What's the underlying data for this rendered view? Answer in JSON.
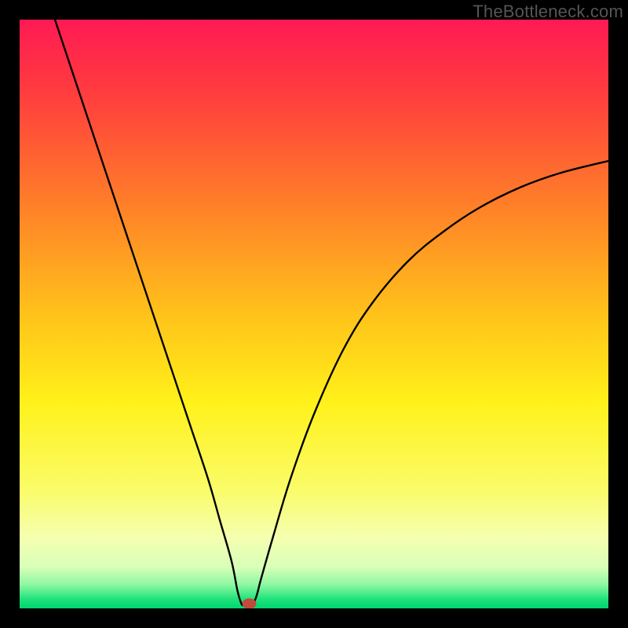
{
  "watermark": "TheBottleneck.com",
  "chart_data": {
    "type": "line",
    "title": "",
    "xlabel": "",
    "ylabel": "",
    "xlim": [
      0,
      100
    ],
    "ylim": [
      0,
      100
    ],
    "background_gradient": {
      "stops": [
        {
          "offset": 0.0,
          "color": "#ff1a53"
        },
        {
          "offset": 0.12,
          "color": "#ff3b3f"
        },
        {
          "offset": 0.3,
          "color": "#ff7a2a"
        },
        {
          "offset": 0.5,
          "color": "#ffc21a"
        },
        {
          "offset": 0.65,
          "color": "#fff11a"
        },
        {
          "offset": 0.8,
          "color": "#fafc6a"
        },
        {
          "offset": 0.88,
          "color": "#f5ffb0"
        },
        {
          "offset": 0.93,
          "color": "#d8ffb8"
        },
        {
          "offset": 0.96,
          "color": "#8cf7a2"
        },
        {
          "offset": 0.985,
          "color": "#1de27a"
        },
        {
          "offset": 1.0,
          "color": "#00d56f"
        }
      ]
    },
    "curve": {
      "description": "V-shaped bottleneck curve with sharp minimum",
      "min_x": 38,
      "min_y": 0,
      "points": [
        {
          "x": 6.0,
          "y": 100.0
        },
        {
          "x": 8.0,
          "y": 94.0
        },
        {
          "x": 11.0,
          "y": 85.0
        },
        {
          "x": 14.0,
          "y": 76.0
        },
        {
          "x": 17.0,
          "y": 67.0
        },
        {
          "x": 20.0,
          "y": 58.0
        },
        {
          "x": 23.0,
          "y": 49.0
        },
        {
          "x": 26.0,
          "y": 40.0
        },
        {
          "x": 29.0,
          "y": 31.0
        },
        {
          "x": 32.0,
          "y": 22.0
        },
        {
          "x": 34.0,
          "y": 15.0
        },
        {
          "x": 36.0,
          "y": 8.0
        },
        {
          "x": 37.0,
          "y": 3.0
        },
        {
          "x": 37.6,
          "y": 1.0
        },
        {
          "x": 38.0,
          "y": 0.5
        },
        {
          "x": 39.4,
          "y": 0.5
        },
        {
          "x": 40.2,
          "y": 2.0
        },
        {
          "x": 41.0,
          "y": 5.0
        },
        {
          "x": 43.0,
          "y": 12.0
        },
        {
          "x": 46.0,
          "y": 22.0
        },
        {
          "x": 50.0,
          "y": 33.0
        },
        {
          "x": 55.0,
          "y": 44.0
        },
        {
          "x": 60.0,
          "y": 52.0
        },
        {
          "x": 66.0,
          "y": 59.0
        },
        {
          "x": 72.0,
          "y": 64.0
        },
        {
          "x": 78.0,
          "y": 68.0
        },
        {
          "x": 85.0,
          "y": 71.5
        },
        {
          "x": 92.0,
          "y": 74.0
        },
        {
          "x": 100.0,
          "y": 76.0
        }
      ]
    },
    "marker": {
      "x": 39.0,
      "y": 0.8,
      "rx": 1.2,
      "ry": 0.9,
      "color": "#c24a3a"
    }
  }
}
